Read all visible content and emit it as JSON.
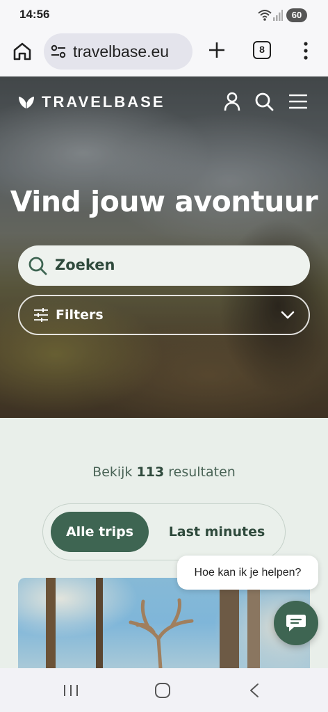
{
  "status_bar": {
    "time": "14:56",
    "battery": "60",
    "icons": [
      "wifi-icon",
      "signal-icon",
      "battery-icon"
    ]
  },
  "browser": {
    "url": "travelbase.eu",
    "tab_count": "8",
    "icons": [
      "home-icon",
      "tune-icon",
      "plus-icon",
      "tabs-icon",
      "more-vert-icon"
    ]
  },
  "header": {
    "brand": "TRAVELBASE",
    "icons": [
      "leaf-logo-icon",
      "user-icon",
      "search-icon",
      "menu-icon"
    ]
  },
  "hero": {
    "title": "Vind jouw avontuur",
    "search_placeholder": "Zoeken",
    "filters_label": "Filters"
  },
  "results": {
    "prefix": "Bekijk",
    "count": "113",
    "suffix": "resultaten"
  },
  "toggle": {
    "active": "Alle trips",
    "inactive": "Last minutes"
  },
  "chat": {
    "prompt": "Hoe kan ik je helpen?"
  },
  "colors": {
    "brand_green": "#3e6552",
    "background": "#e9efea",
    "text_dark": "#2f4a3c"
  }
}
